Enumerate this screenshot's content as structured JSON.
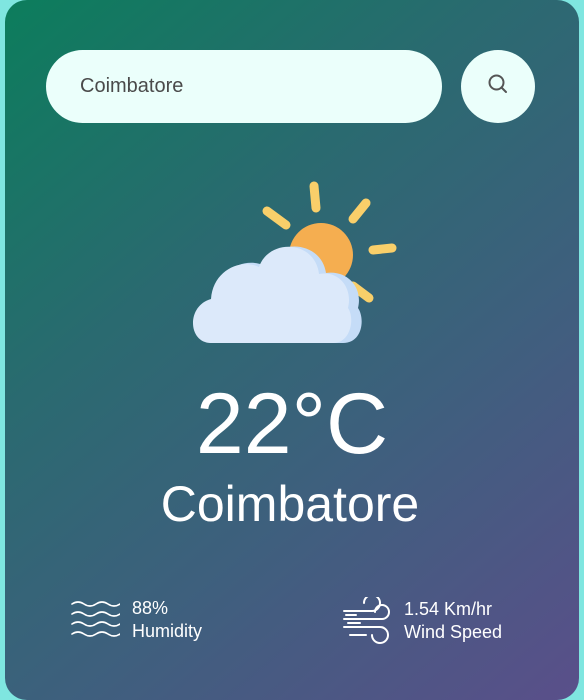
{
  "search": {
    "value": "Coimbatore",
    "icon": "search-icon"
  },
  "weather": {
    "icon": "partly-cloudy-icon",
    "temperature": "22°C",
    "city": "Coimbatore"
  },
  "details": {
    "humidity": {
      "value": "88%",
      "label": "Humidity",
      "icon": "humidity-icon"
    },
    "wind": {
      "value": "1.54 Km/hr",
      "label": "Wind Speed",
      "icon": "wind-icon"
    }
  },
  "colors": {
    "gradient_start": "#0c7d5c",
    "gradient_end": "#5a4f8a",
    "search_bg": "#ebfffb",
    "sun": "#f5ae50",
    "sun_rays": "#f9cf6a",
    "cloud": "#dce9fa"
  }
}
